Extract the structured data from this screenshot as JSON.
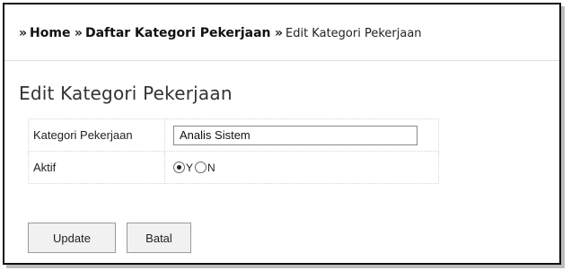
{
  "breadcrumb": {
    "separator": "»",
    "items": [
      {
        "label": "Home"
      },
      {
        "label": "Daftar Kategori Pekerjaan"
      }
    ],
    "current": "Edit Kategori Pekerjaan"
  },
  "page": {
    "title": "Edit Kategori Pekerjaan"
  },
  "form": {
    "fields": [
      {
        "label": "Kategori Pekerjaan",
        "value": "Analis Sistem"
      },
      {
        "label": "Aktif"
      }
    ],
    "aktif_options": [
      {
        "label": "Y",
        "checked": true
      },
      {
        "label": "N",
        "checked": false
      }
    ]
  },
  "buttons": {
    "update_label": "Update",
    "batal_label": "Batal"
  }
}
